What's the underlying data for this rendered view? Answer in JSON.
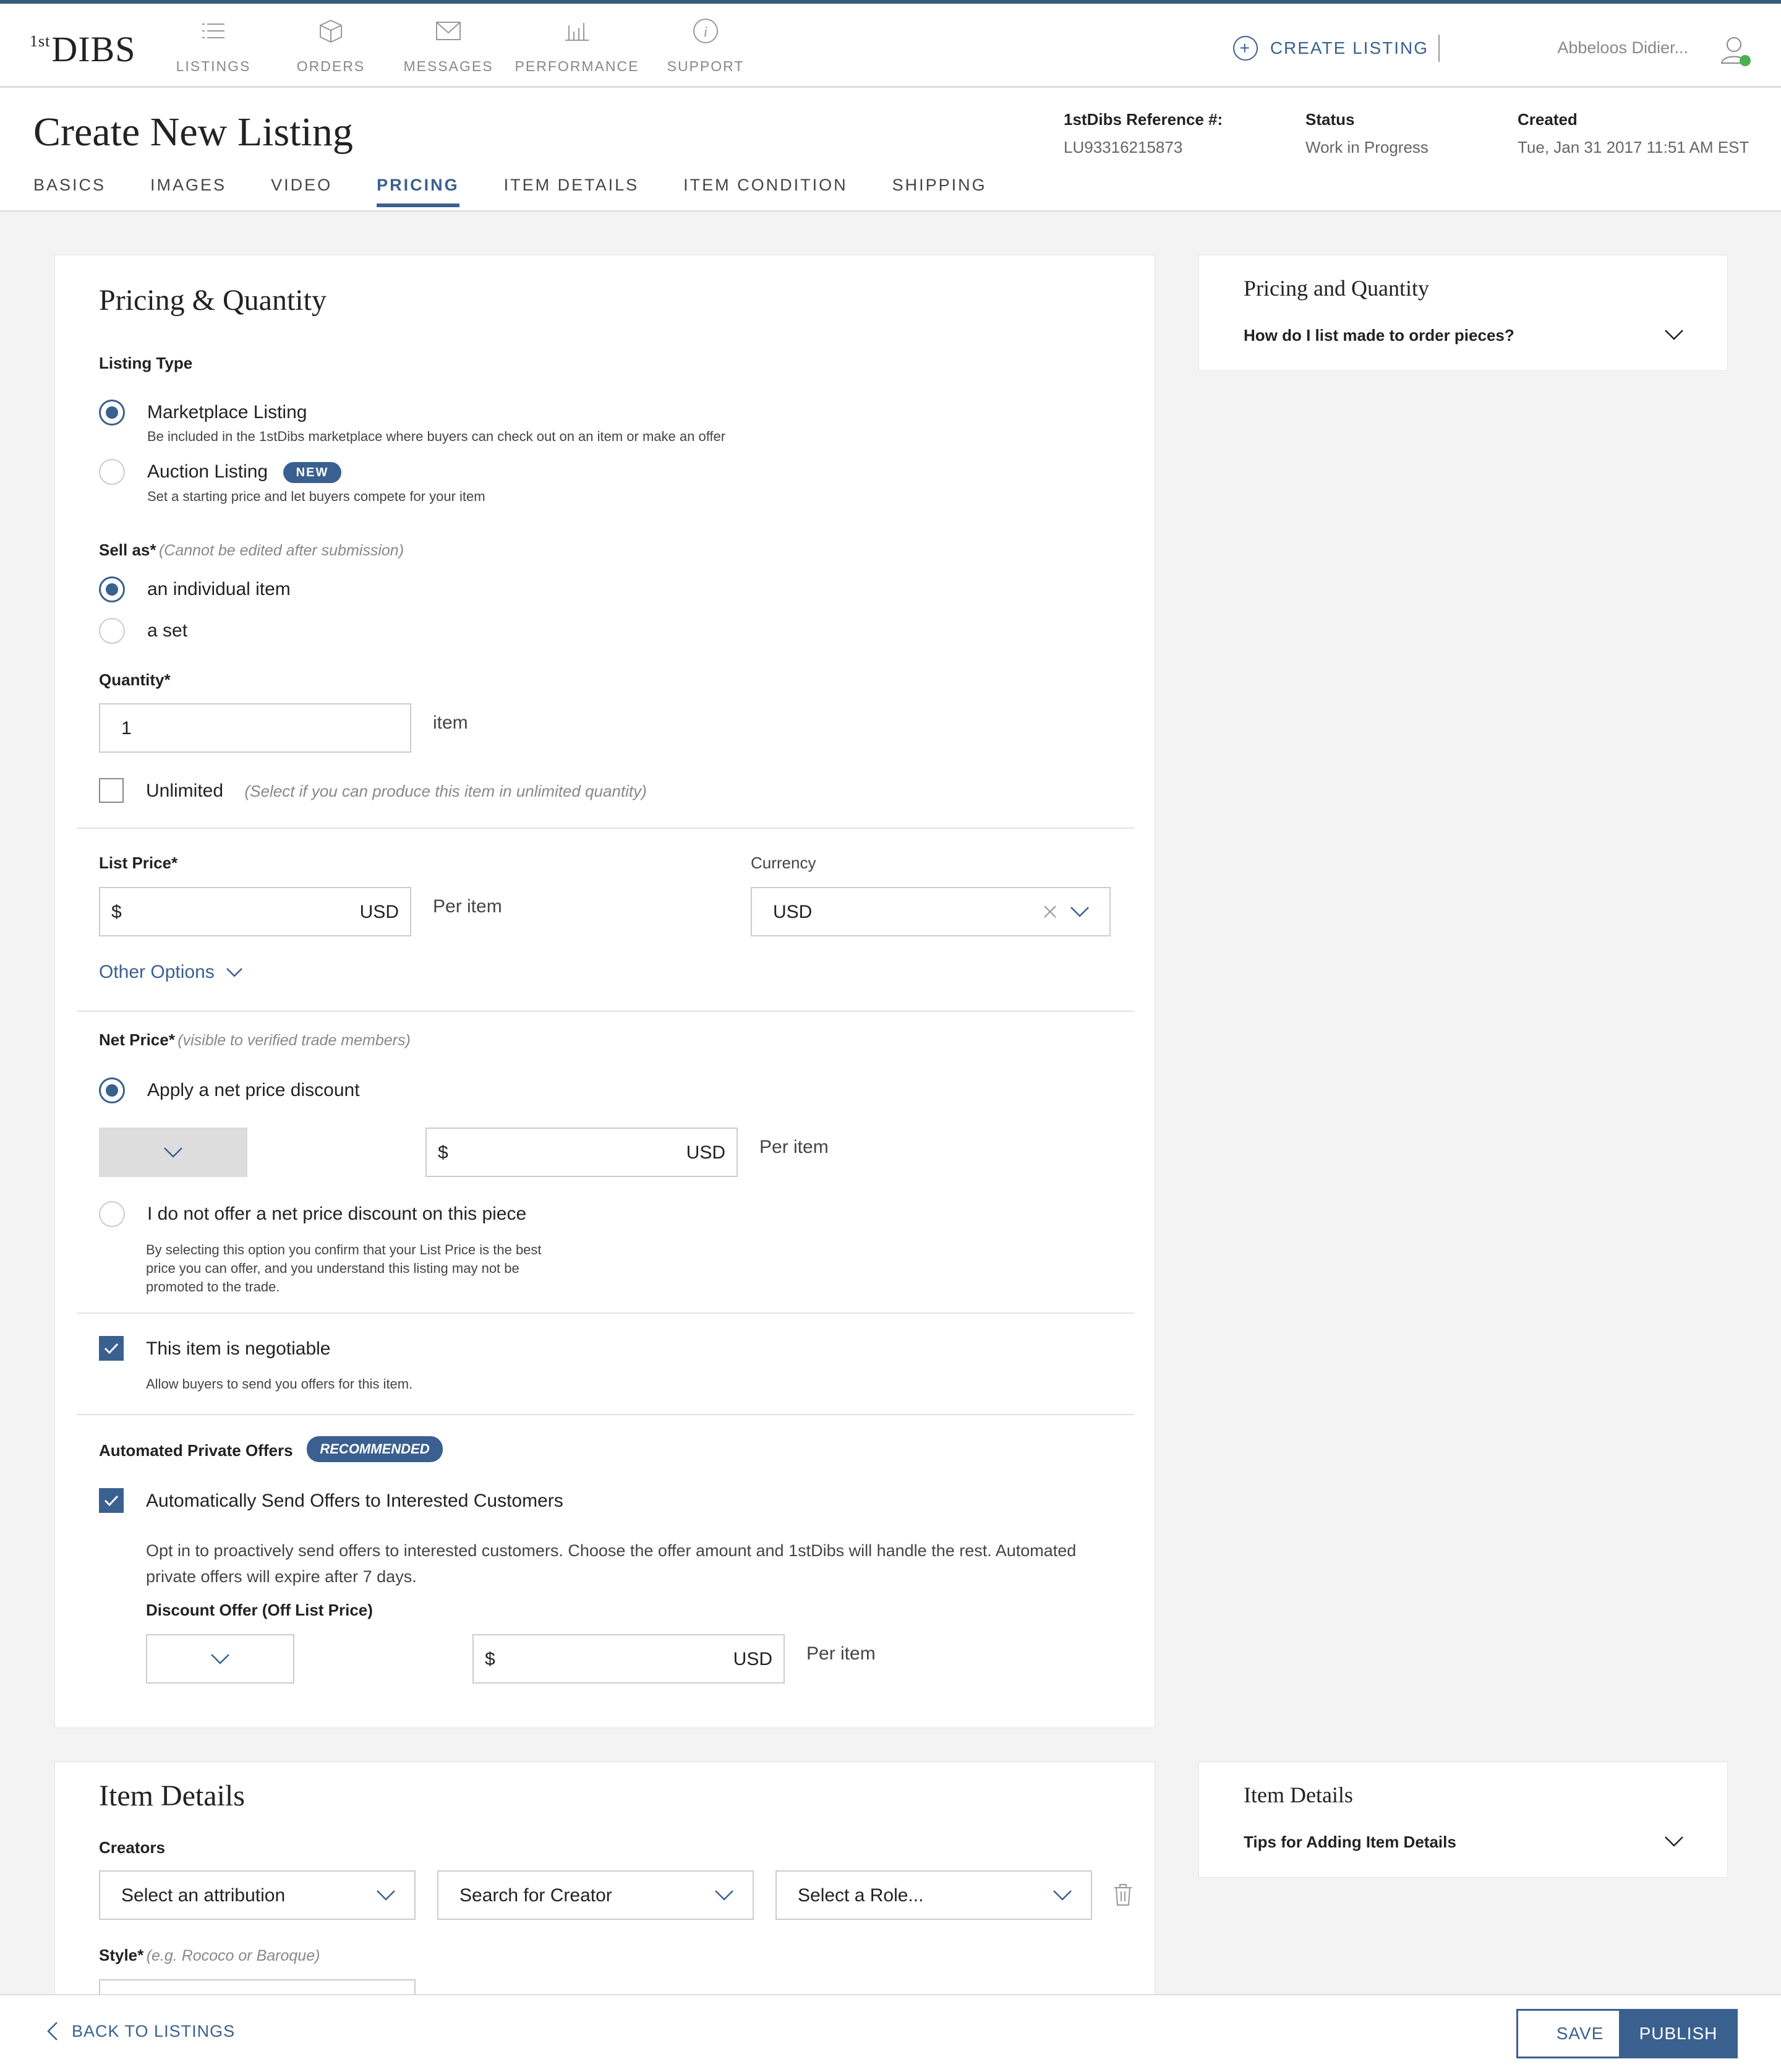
{
  "brand": {
    "logo_sup": "1st",
    "logo_text": "DIBS"
  },
  "nav": [
    {
      "label": "LISTINGS",
      "icon": "list-icon"
    },
    {
      "label": "ORDERS",
      "icon": "box-icon"
    },
    {
      "label": "MESSAGES",
      "icon": "envelope-icon"
    },
    {
      "label": "PERFORMANCE",
      "icon": "bar-chart-icon"
    },
    {
      "label": "SUPPORT",
      "icon": "info-icon"
    }
  ],
  "header": {
    "create_listing": "CREATE LISTING",
    "user": "Abbeloos Didier...",
    "status_color": "#4caf50",
    "accent": "#3a6090"
  },
  "page": {
    "title": "Create New Listing",
    "ref_label": "1stDibs Reference #:",
    "ref_value": "LU93316215873",
    "status_label": "Status",
    "status_value": "Work in Progress",
    "created_label": "Created",
    "created_value": "Tue, Jan 31 2017 11:51 AM EST"
  },
  "tabs": [
    "BASICS",
    "IMAGES",
    "VIDEO",
    "PRICING",
    "ITEM DETAILS",
    "ITEM CONDITION",
    "SHIPPING"
  ],
  "active_tab": "PRICING",
  "pricing": {
    "title": "Pricing & Quantity",
    "listing_type_label": "Listing Type",
    "marketplace": {
      "title": "Marketplace Listing",
      "desc": "Be included in the 1stDibs marketplace where buyers can check out on an item or make an offer"
    },
    "auction": {
      "title": "Auction Listing",
      "badge": "NEW",
      "desc": "Set a starting price and let buyers compete for your item"
    },
    "sell_as_label": "Sell as*",
    "sell_as_hint": "(Cannot be edited after submission)",
    "sell_individual": "an individual item",
    "sell_set": "a set",
    "quantity_label": "Quantity*",
    "quantity_value": "1",
    "quantity_unit": "item",
    "unlimited_label": "Unlimited",
    "unlimited_hint": "(Select if you can produce this item in unlimited quantity)",
    "list_price_label": "List Price*",
    "currency_symbol": "$",
    "currency_code": "USD",
    "per_item": "Per item",
    "currency_label": "Currency",
    "currency_value": "USD",
    "other_options": "Other Options",
    "net_price_label": "Net Price*",
    "net_price_hint": "(visible to verified trade members)",
    "apply_discount": "Apply a net price discount",
    "no_discount": "I do not offer a net price discount on this piece",
    "no_discount_desc1": "By selecting this option you confirm that your List Price is the best",
    "no_discount_desc2": "price you can offer, and you understand this listing may not be",
    "no_discount_desc3": "promoted to the trade.",
    "negotiable": "This item is negotiable",
    "negotiable_desc": "Allow buyers to send you offers for this item.",
    "auto_offers_label": "Automated Private Offers",
    "recommended": "RECOMMENDED",
    "auto_send": "Automatically Send Offers to Interested Customers",
    "auto_desc1": "Opt in to proactively send offers to interested customers. Choose the offer amount and 1stDibs will handle the rest. Automated",
    "auto_desc2": "private offers will expire after 7 days.",
    "discount_offer_label": "Discount Offer (Off List Price)"
  },
  "help1": {
    "title": "Pricing and Quantity",
    "question": "How do I list made to order pieces?"
  },
  "item_details": {
    "title": "Item Details",
    "creators_label": "Creators",
    "attribution_ph": "Select an attribution",
    "creator_ph": "Search for Creator",
    "role_ph": "Select a Role...",
    "style_label": "Style*",
    "style_hint": "(e.g. Rococo or Baroque)"
  },
  "help2": {
    "title": "Item Details",
    "question": "Tips for Adding Item Details"
  },
  "footer": {
    "back": "BACK TO LISTINGS",
    "save": "SAVE",
    "publish": "PUBLISH"
  }
}
